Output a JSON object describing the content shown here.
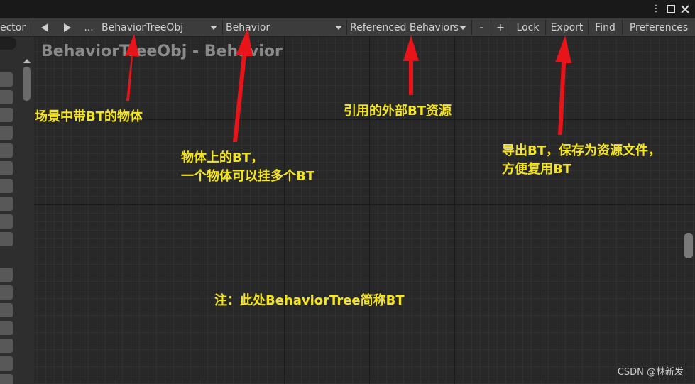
{
  "window": {
    "menu_icon": "more-vert-icon",
    "maximize_icon": "maximize-icon",
    "close_icon": "close-icon"
  },
  "toolbar": {
    "inspector_tab_label": "ector",
    "prev_icon": "triangle-left-icon",
    "next_icon": "triangle-right-icon",
    "more_label": "...",
    "object_dropdown": "BehaviorTreeObj",
    "behavior_dropdown": "Behavior",
    "referenced_dropdown": "Referenced Behaviors",
    "minus_label": "-",
    "plus_label": "+",
    "lock_label": "Lock",
    "export_label": "Export",
    "find_label": "Find",
    "preferences_label": "Preferences"
  },
  "graph": {
    "title": "BehaviorTreeObj - Behavior"
  },
  "annotations": {
    "object_note": "场景中带BT的物体",
    "bt_note_line1": "物体上的BT，",
    "bt_note_line2": "一个物体可以挂多个BT",
    "referenced_note": "引用的外部BT资源",
    "export_note_line1": "导出BT，保存为资源文件，",
    "export_note_line2": "方便复用BT",
    "abbrev_note": "注：此处BehaviorTree简称BT"
  },
  "watermark": "CSDN @林新发",
  "colors": {
    "annotation_text": "#f5e51b",
    "arrow": "#e8141a",
    "toolbar_bg": "#3c3c3c",
    "graph_bg": "#282828"
  }
}
